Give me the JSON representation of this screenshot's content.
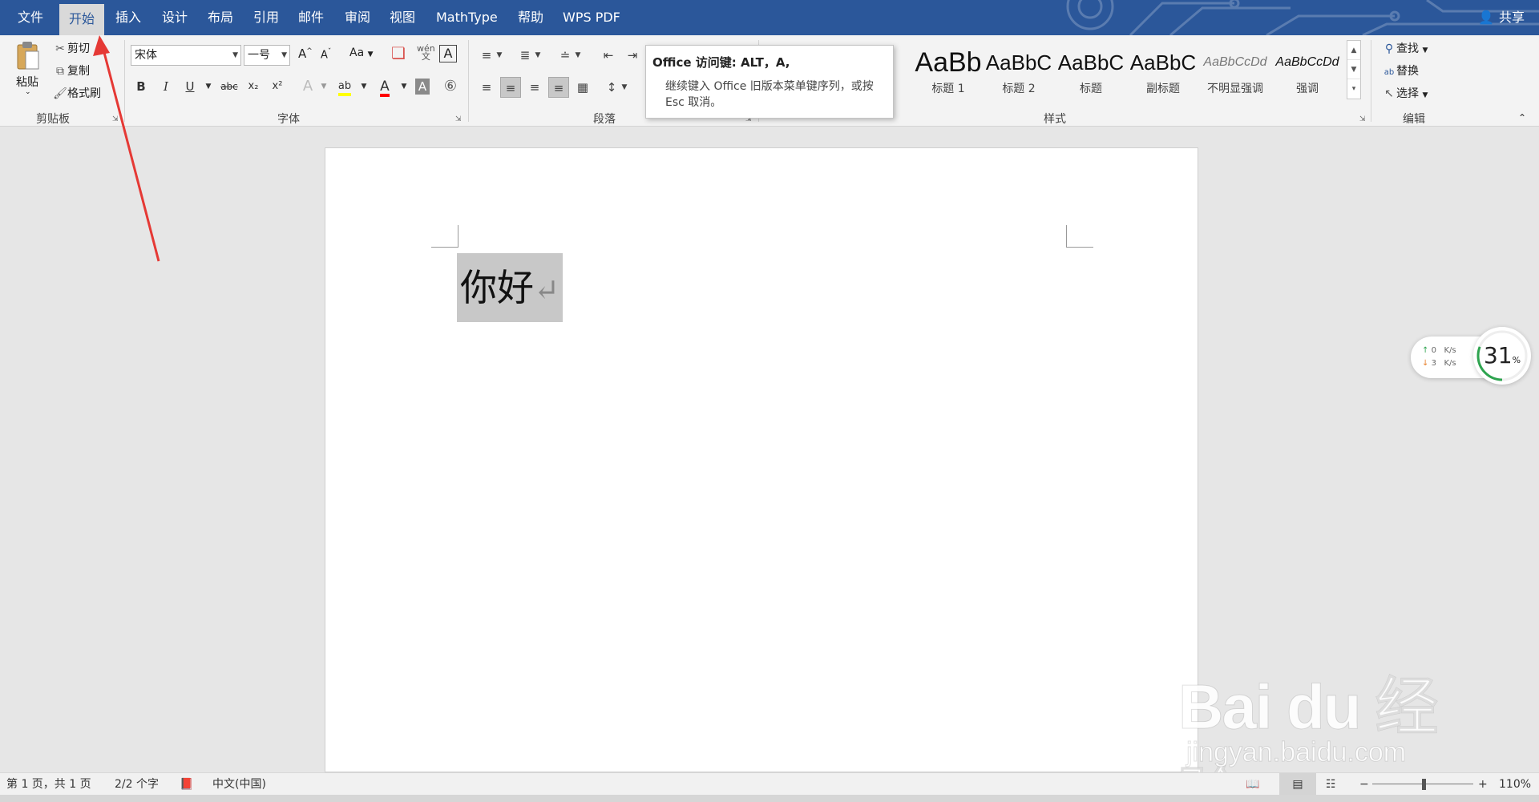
{
  "tabs": [
    {
      "id": "file",
      "label": "文件",
      "active": false
    },
    {
      "id": "home",
      "label": "开始",
      "active": true
    },
    {
      "id": "insert",
      "label": "插入",
      "active": false
    },
    {
      "id": "design",
      "label": "设计",
      "active": false
    },
    {
      "id": "layout",
      "label": "布局",
      "active": false
    },
    {
      "id": "references",
      "label": "引用",
      "active": false
    },
    {
      "id": "mailings",
      "label": "邮件",
      "active": false
    },
    {
      "id": "review",
      "label": "审阅",
      "active": false
    },
    {
      "id": "view",
      "label": "视图",
      "active": false
    },
    {
      "id": "mathtype",
      "label": "MathType",
      "active": false
    },
    {
      "id": "help",
      "label": "帮助",
      "active": false
    },
    {
      "id": "wpspdf",
      "label": "WPS PDF",
      "active": false
    }
  ],
  "share_label": "共享",
  "clipboard": {
    "paste_label": "粘贴",
    "cut_label": "剪切",
    "copy_label": "复制",
    "format_painter_label": "格式刷",
    "group_label": "剪贴板"
  },
  "font": {
    "font_name": "宋体",
    "font_size": "一号",
    "change_case": "Aa",
    "bold": "B",
    "italic": "I",
    "underline": "U",
    "strikethrough": "abc",
    "subscript": "x₂",
    "superscript": "x²",
    "group_label": "字体"
  },
  "paragraph": {
    "group_label": "段落"
  },
  "styles": {
    "items": [
      {
        "sample": "AaBb",
        "name": "标题 1"
      },
      {
        "sample": "AaBbC",
        "name": "标题 2"
      },
      {
        "sample": "AaBbC",
        "name": "标题"
      },
      {
        "sample": "AaBbC",
        "name": "副标题"
      },
      {
        "sample": "AaBbCcDd",
        "name": "不明显强调"
      },
      {
        "sample": "AaBbCcDd",
        "name": "强调"
      }
    ],
    "group_label": "样式"
  },
  "editing": {
    "find_label": "查找",
    "replace_label": "替换",
    "select_label": "选择",
    "group_label": "编辑"
  },
  "tooltip": {
    "title": "Office 访问键: ALT，A,",
    "body": "继续键入 Office 旧版本菜单键序列，或按 Esc 取消。"
  },
  "document": {
    "text": "你好",
    "paragraph_mark": "↵"
  },
  "net_widget": {
    "upload": "0",
    "download": "3",
    "unit": "K/s",
    "percent": "31",
    "percent_sign": "%",
    "percent_value": 0.31,
    "ring_color": "#2ea44f"
  },
  "watermark": {
    "logo": "Bai du 经验",
    "url": "jingyan.baidu.com"
  },
  "statusbar": {
    "page_info": "第 1 页，共 1 页",
    "word_count": "2/2 个字",
    "language": "中文(中国)",
    "zoom": "110%",
    "zoom_minus": "−",
    "zoom_plus": "+"
  },
  "annotation": {
    "arrow_color": "#e53935"
  },
  "colors": {
    "accent": "#2b579a",
    "highlight": "#ffff00",
    "font_color": "#ff0000"
  }
}
